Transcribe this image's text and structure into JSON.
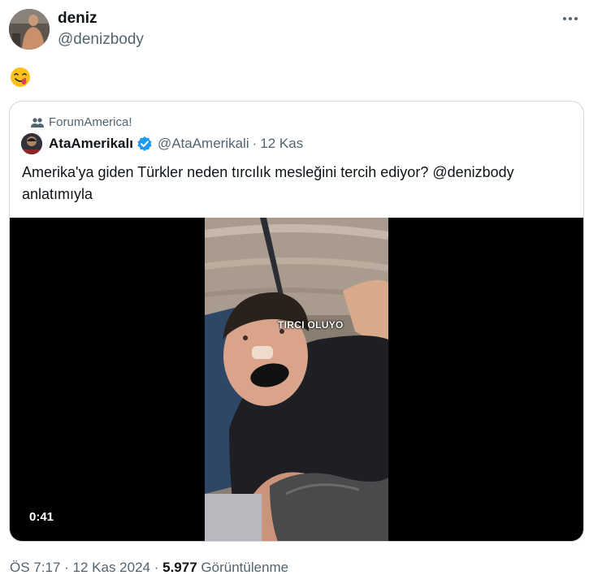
{
  "author": {
    "name": "deniz",
    "handle": "@denizbody"
  },
  "tweet": {
    "emoji": "😋"
  },
  "quote": {
    "community": "ForumAmerica!",
    "author_name": "AtaAmerikalı",
    "author_handle": "@AtaAmerikali",
    "separator": "·",
    "date": "12 Kas",
    "text": "Amerika'ya giden Türkler neden tırcılık mesleğini tercih ediyor? @denizbody anlatımıyla",
    "video": {
      "caption": "TIRCI OLUYO",
      "duration": "0:41"
    }
  },
  "meta": {
    "time": "ÖS 7:17",
    "separator": "·",
    "date": "12 Kas 2024",
    "views_count": "5.977",
    "views_label": "Görüntülenme"
  },
  "colors": {
    "text_primary": "#0f1419",
    "text_secondary": "#536471",
    "border": "#cfd9de",
    "verified": "#1d9bf0"
  },
  "icons": {
    "more": "more-dots-icon",
    "community": "community-people-icon",
    "verified": "verified-badge-icon"
  }
}
